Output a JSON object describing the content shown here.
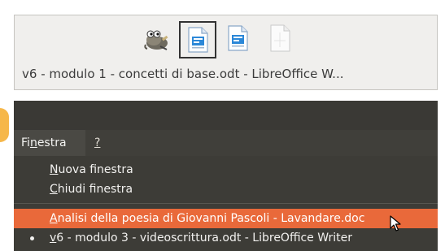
{
  "switcher": {
    "window_title": "v6 - modulo 1 - concetti di base.odt - LibreOffice W...",
    "icons": [
      "gimp-icon",
      "writer-document-icon",
      "writer-document-icon",
      "blank-document-icon"
    ],
    "selected_index": 1
  },
  "menu": {
    "header_prefix": "Fi",
    "header_mnemonic": "n",
    "header_suffix": "estra",
    "help_label": "?",
    "items": [
      {
        "mnemonic": "N",
        "rest": "uova finestra"
      },
      {
        "mnemonic": "C",
        "rest": "hiudi finestra"
      }
    ],
    "windows": [
      {
        "mnemonic": "A",
        "rest": "nalisi della poesia di Giovanni Pascoli - Lavandare.doc",
        "highlighted": true,
        "active": false
      },
      {
        "mnemonic": "v",
        "rest": "6 - modulo 3 - videoscrittura.odt - LibreOffice Writer",
        "highlighted": false,
        "active": true
      }
    ]
  },
  "colors": {
    "highlight": "#e9693a",
    "menu_background": "#3d3c37",
    "switcher_background": "#f0efed",
    "accent_tab": "#f6b74a"
  }
}
